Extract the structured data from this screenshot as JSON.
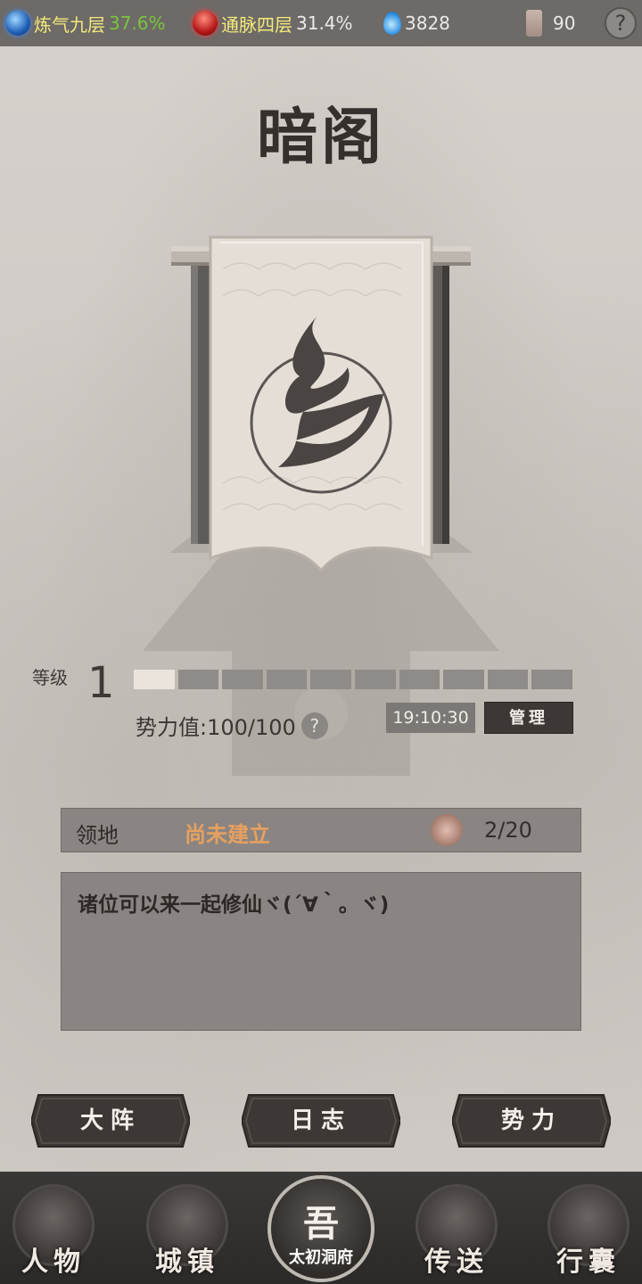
{
  "topbar": {
    "cultivation_name": "炼气九层",
    "cultivation_pct": "37.6%",
    "meridian_name": "通脉四层",
    "meridian_pct": "31.4%",
    "spirit_stones": "3828",
    "scrolls": "90",
    "help": "?"
  },
  "title": "暗阁",
  "level": {
    "label": "等级",
    "value": "1",
    "progress_segments_filled": 1,
    "progress_segments_total": 10
  },
  "power": {
    "label": "势力值:100/100",
    "help": "?"
  },
  "timer": "19:10:30",
  "manage_label": "管理",
  "territory": {
    "label": "领地",
    "status": "尚未建立",
    "members": "2/20"
  },
  "notice": "诸位可以来一起修仙ヾ(´∀｀。ヾ)",
  "actions": {
    "formation": "大阵",
    "log": "日志",
    "faction": "势力"
  },
  "nav": {
    "character": "人物",
    "town": "城镇",
    "home_char": "吾",
    "home_label": "太初洞府",
    "teleport": "传送",
    "bag": "行囊"
  }
}
